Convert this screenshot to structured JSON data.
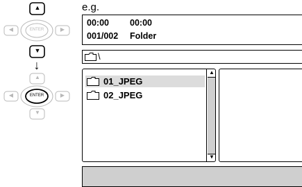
{
  "remote": {
    "enter_label": "ENTER",
    "up_glyph": "▲",
    "down_glyph": "▼",
    "left_glyph": "◀",
    "right_glyph": "▶",
    "step_arrow_glyph": "↓"
  },
  "example_label": "e.g.",
  "info": {
    "time_elapsed": "00:00",
    "time_total": "00:00",
    "track_index": "001/002",
    "track_type": "Folder"
  },
  "path": {
    "text": "\\"
  },
  "files": [
    {
      "name": "01_JPEG",
      "selected": true
    },
    {
      "name": "02_JPEG",
      "selected": false
    }
  ],
  "scrollbar": {
    "up_glyph": "▲",
    "down_glyph": "▼"
  },
  "colors": {
    "highlight": "#dcdcdc",
    "status_bar": "#cfcfcf",
    "disabled_button": "#b8b8b8"
  }
}
